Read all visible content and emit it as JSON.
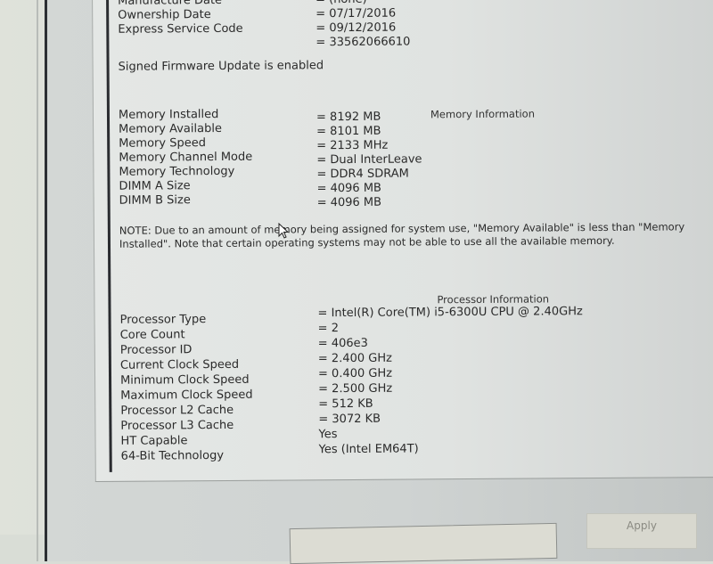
{
  "system_info": {
    "top_rows": [
      {
        "label": "Manufacture Date",
        "value": "= (none)"
      },
      {
        "label": "Ownership Date",
        "value": "= 07/17/2016"
      },
      {
        "label": "Express Service Code",
        "value": "= 09/12/2016"
      },
      {
        "label": "",
        "value": "= 33562066610"
      }
    ],
    "firmware_status": "Signed Firmware Update is enabled"
  },
  "memory": {
    "title": "Memory Information",
    "rows": [
      {
        "label": "Memory Installed",
        "value": "= 8192 MB"
      },
      {
        "label": "Memory Available",
        "value": "= 8101 MB"
      },
      {
        "label": "Memory Speed",
        "value": "= 2133 MHz"
      },
      {
        "label": "Memory Channel Mode",
        "value": "= Dual InterLeave"
      },
      {
        "label": "Memory Technology",
        "value": "= DDR4 SDRAM"
      },
      {
        "label": "DIMM A Size",
        "value": "= 4096 MB"
      },
      {
        "label": "DIMM B Size",
        "value": "= 4096 MB"
      }
    ],
    "note": "NOTE: Due to an amount of memory being assigned for system use, \"Memory Available\" is less than \"Memory Installed\". Note that certain operating systems may not be able to use all the available memory."
  },
  "processor": {
    "title": "Processor Information",
    "rows": [
      {
        "label": "Processor Type",
        "value": "= Intel(R) Core(TM) i5-6300U CPU @ 2.40GHz"
      },
      {
        "label": "Core Count",
        "value": "= 2"
      },
      {
        "label": "Processor ID",
        "value": "= 406e3"
      },
      {
        "label": "Current Clock Speed",
        "value": "= 2.400 GHz"
      },
      {
        "label": "Minimum Clock Speed",
        "value": "= 0.400 GHz"
      },
      {
        "label": "Maximum Clock Speed",
        "value": "= 2.500 GHz"
      },
      {
        "label": "Processor L2 Cache",
        "value": "= 512 KB"
      },
      {
        "label": "Processor L3 Cache",
        "value": "= 3072 KB"
      },
      {
        "label": "HT Capable",
        "value": "Yes"
      },
      {
        "label": "64-Bit Technology",
        "value": "Yes (Intel EM64T)"
      }
    ]
  },
  "buttons": {
    "apply_label": "Apply"
  }
}
